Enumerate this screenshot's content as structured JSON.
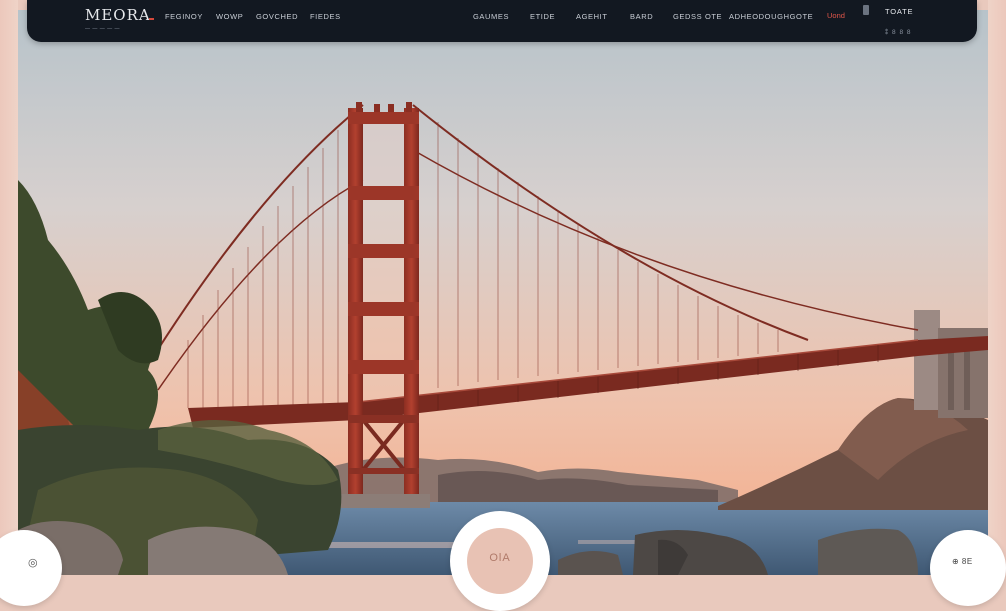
{
  "nav": {
    "logo": "MEORA",
    "logo_tagline": "— — — — —",
    "links_left": [
      "FEGINOY",
      "WOWP",
      "GOVCHED",
      "FIEDES"
    ],
    "links_right": [
      "GAUMES",
      "ETIDE",
      "AGEHIT",
      "BARD",
      "GEDSS OTE",
      "ADHEODOUGHGOTE"
    ],
    "cta": "Uond",
    "account": "TOATE",
    "account_sub": "⁑ 8 8 8"
  },
  "hero": {
    "center_button_label": "OlA",
    "left_button_icon": "gear-icon",
    "right_button_label": "⊕ 8E"
  },
  "colors": {
    "navbar_bg": "#121821",
    "accent_red": "#d6483b",
    "bridge_red": "#a8392a",
    "sky_top": "#b9c4cb",
    "sky_bottom": "#f1b89a",
    "water": "#4f6c88",
    "frame_peach": "#ecc8bc"
  }
}
